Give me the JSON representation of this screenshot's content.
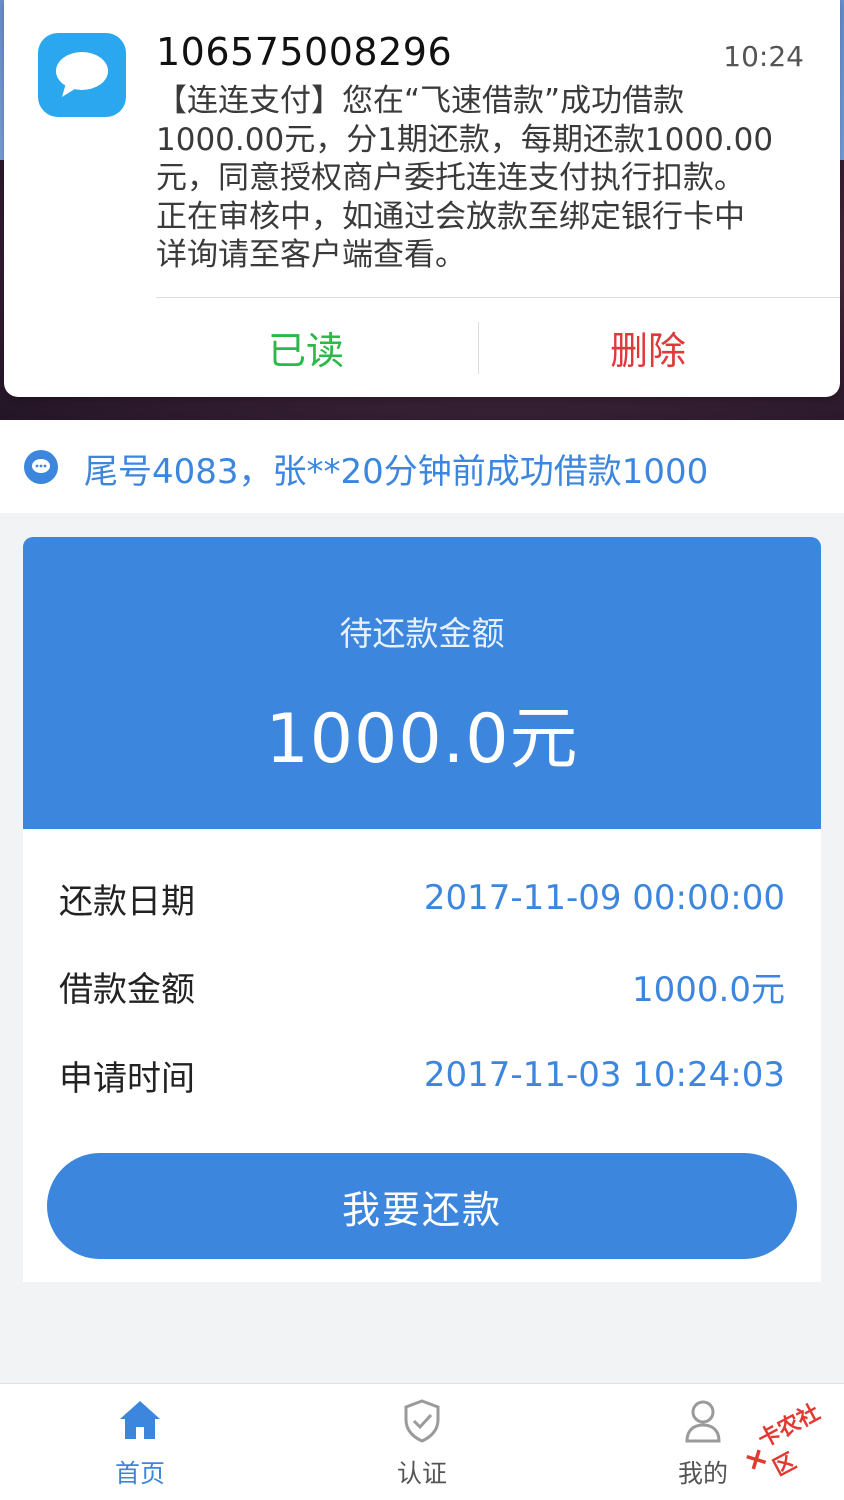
{
  "notification": {
    "sender": "106575008296",
    "time": "10:24",
    "body_lines": [
      "【连连支付】您在“飞速借款”成功借款",
      "1000.00元，分1期还款，每期还款1000.00",
      "元，同意授权商户委托连连支付执行扣款。",
      "正在审核中，如通过会放款至绑定银行卡中",
      "详询请至客户端查看。"
    ],
    "read_label": "已读",
    "delete_label": "删除"
  },
  "notice": {
    "text": "尾号4083，张**20分钟前成功借款1000"
  },
  "card": {
    "due_label": "待还款金额",
    "due_amount": "1000.0元",
    "rows": [
      {
        "label": "还款日期",
        "value": "2017-11-09 00:00:00"
      },
      {
        "label": "借款金额",
        "value": "1000.0元"
      },
      {
        "label": "申请时间",
        "value": "2017-11-03 10:24:03"
      }
    ],
    "repay_button": "我要还款"
  },
  "tabbar": {
    "tabs": [
      {
        "label": "首页",
        "icon": "home-icon",
        "active": true
      },
      {
        "label": "认证",
        "icon": "shield-check-icon",
        "active": false
      },
      {
        "label": "我的",
        "icon": "user-icon",
        "active": false
      }
    ]
  },
  "watermark": {
    "text": "卡农社区"
  },
  "colors": {
    "accent": "#3d86de",
    "read": "#2db84a",
    "delete": "#e0393b",
    "sms_icon": "#2aa7ee"
  }
}
